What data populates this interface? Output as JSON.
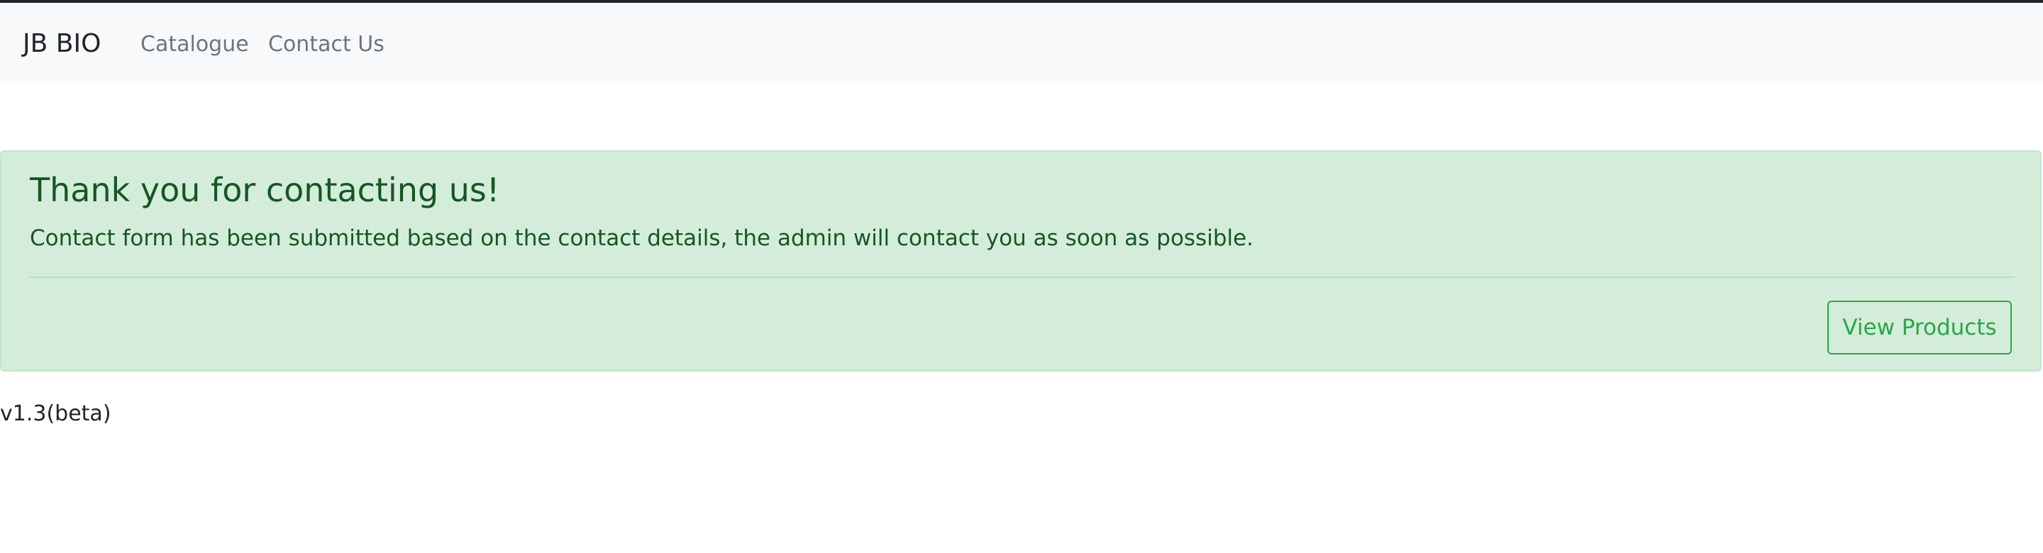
{
  "colors": {
    "navbar_bg": "#f8f9fa",
    "nav_link": "#6c757d",
    "alert_bg": "#d4edda",
    "alert_text": "#155724",
    "button_accent": "#28a745"
  },
  "navbar": {
    "brand": "JB BIO",
    "links": [
      {
        "label": "Catalogue"
      },
      {
        "label": "Contact Us"
      }
    ]
  },
  "alert": {
    "heading": "Thank you for contacting us!",
    "message": "Contact form has been submitted based on the contact details, the admin will contact you as soon as possible.",
    "button_label": "View Products"
  },
  "footer": {
    "version": "v1.3(beta)"
  }
}
